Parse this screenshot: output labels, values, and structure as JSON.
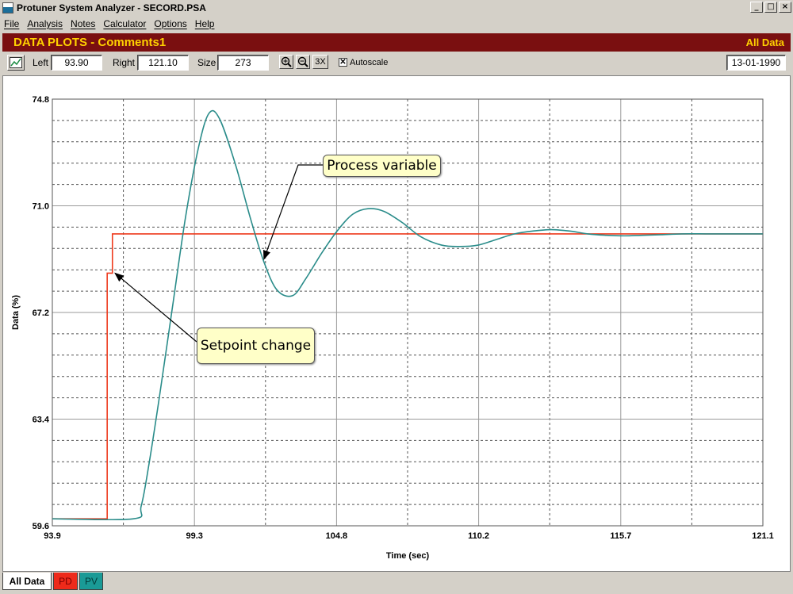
{
  "window": {
    "title": "Protuner System Analyzer - SECORD.PSA",
    "buttons": {
      "minimize": "_",
      "maximize": "□",
      "close": "×"
    }
  },
  "menu": [
    "File",
    "Analysis",
    "Notes",
    "Calculator",
    "Options",
    "Help"
  ],
  "banner": {
    "title": "DATA PLOTS - Comments1",
    "right": "All Data",
    "bg": "#7a0f10",
    "fg": "#ffd200"
  },
  "toolbar": {
    "left_label": "Left",
    "left_value": "93.90",
    "right_label": "Right",
    "right_value": "121.10",
    "size_label": "Size",
    "size_value": "273",
    "zoom_in_icon": "zoom-in-icon",
    "zoom_out_icon": "zoom-out-icon",
    "zoom3x_label": "3X",
    "autoscale_label": "Autoscale",
    "autoscale_checked": true,
    "date": "13-01-1990"
  },
  "chart_data": {
    "type": "line",
    "xlabel": "Time (sec)",
    "ylabel": "Data (%)",
    "xlim": [
      93.9,
      121.1
    ],
    "ylim": [
      59.6,
      74.8
    ],
    "x_ticks": [
      "93.9",
      "99.3",
      "104.8",
      "110.2",
      "115.7",
      "121.1"
    ],
    "y_ticks": [
      "59.6",
      "63.4",
      "67.2",
      "71.0",
      "74.8"
    ],
    "grid": true,
    "series": [
      {
        "name": "PD",
        "color": "#ee3a1d",
        "x": [
          93.9,
          96.0,
          96.0,
          96.2,
          96.2,
          121.1
        ],
        "y": [
          59.85,
          59.85,
          68.6,
          68.6,
          70.0,
          70.0
        ]
      },
      {
        "name": "PV",
        "color": "#2a8c8a",
        "x": [
          93.9,
          97.0,
          97.3,
          97.6,
          98.0,
          98.5,
          99.0,
          99.5,
          99.9,
          100.3,
          100.9,
          101.5,
          102.0,
          102.5,
          103.1,
          103.6,
          104.2,
          104.8,
          105.4,
          106.0,
          106.6,
          107.3,
          108.0,
          108.8,
          109.5,
          110.2,
          110.9,
          111.6,
          112.3,
          113.0,
          113.7,
          114.4,
          115.1,
          115.8,
          116.5,
          117.2,
          118.0,
          119.0,
          120.0,
          121.1
        ],
        "y": [
          59.85,
          59.85,
          60.3,
          61.8,
          64.2,
          67.4,
          70.6,
          73.1,
          74.3,
          74.1,
          72.5,
          70.5,
          69.0,
          68.0,
          67.8,
          68.4,
          69.3,
          70.1,
          70.7,
          70.9,
          70.8,
          70.4,
          69.9,
          69.6,
          69.55,
          69.6,
          69.8,
          70.0,
          70.1,
          70.15,
          70.1,
          70.0,
          69.95,
          69.93,
          69.95,
          69.97,
          70.0,
          70.0,
          70.0,
          70.0
        ]
      }
    ],
    "annotations": [
      {
        "text": "Process variable",
        "target": {
          "x": 102.0,
          "y": 69.1
        }
      },
      {
        "text": "Setpoint change",
        "target": {
          "x": 96.3,
          "y": 68.6
        }
      }
    ]
  },
  "tabs": [
    {
      "label": "All Data",
      "bg": "#ffffff",
      "fg": "#000000"
    },
    {
      "label": "PD",
      "bg": "#ee2a1a",
      "fg": "#7a0000"
    },
    {
      "label": "PV",
      "bg": "#1a9a96",
      "fg": "#003a38"
    }
  ]
}
